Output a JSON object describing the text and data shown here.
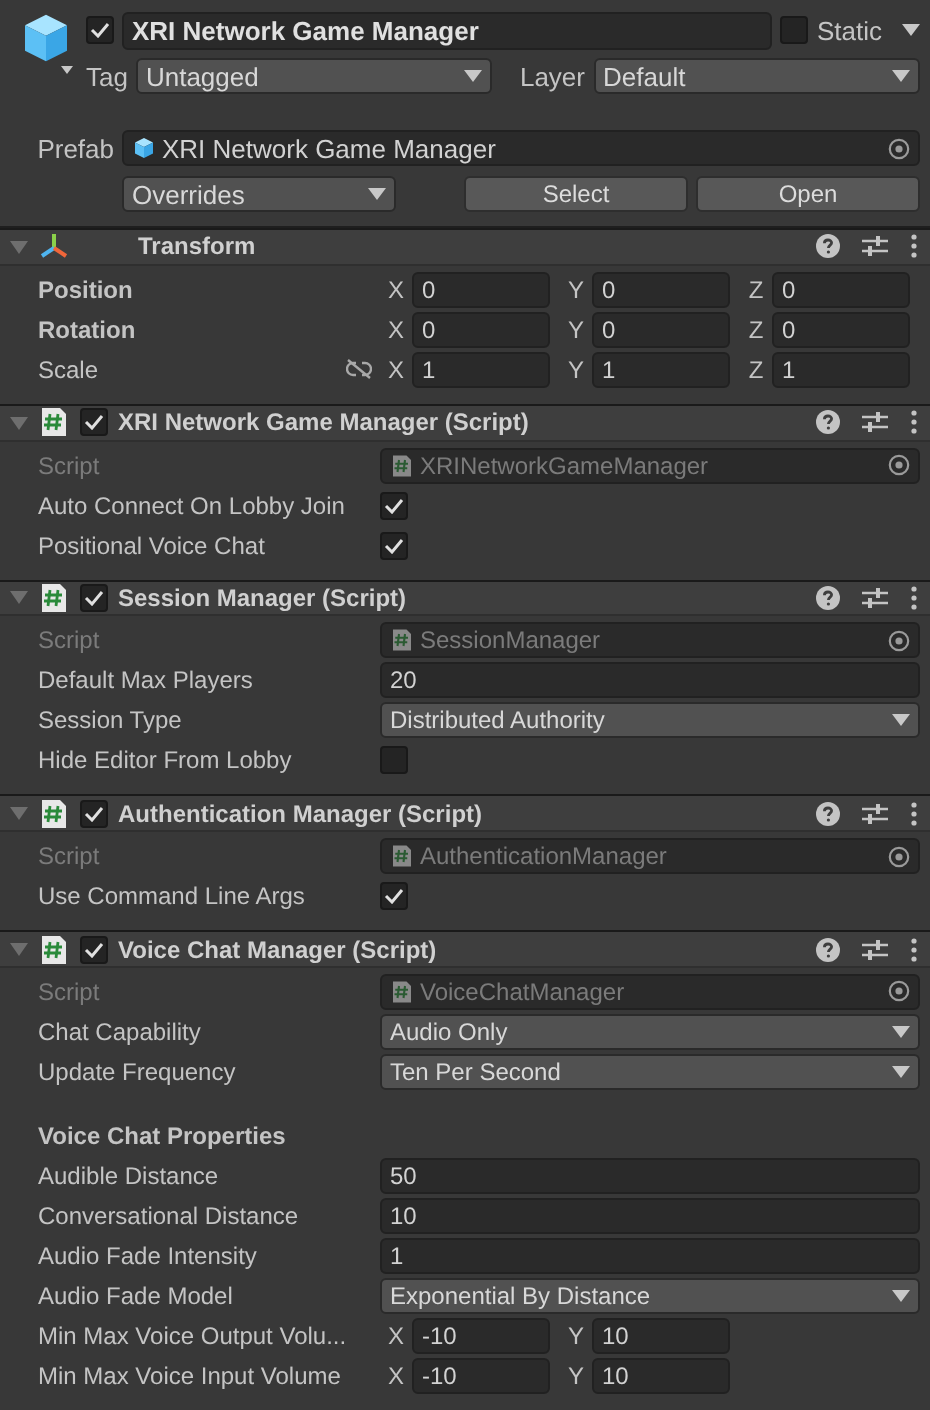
{
  "header": {
    "active": true,
    "name": "XRI Network Game Manager",
    "static": false,
    "static_label": "Static",
    "tag_label": "Tag",
    "tag": "Untagged",
    "layer_label": "Layer",
    "layer": "Default",
    "prefab_label": "Prefab",
    "prefab": "XRI Network Game Manager",
    "overrides": "Overrides",
    "buttons": [
      "Select",
      "Open"
    ]
  },
  "components": [
    {
      "kind": "transform",
      "title": "Transform",
      "expanded": true,
      "rows": [
        {
          "label": "Position",
          "overridden": true,
          "values": [
            {
              "axis": "X",
              "value": "0"
            },
            {
              "axis": "Y",
              "value": "0"
            },
            {
              "axis": "Z",
              "value": "0"
            }
          ]
        },
        {
          "label": "Rotation",
          "overridden": true,
          "values": [
            {
              "axis": "X",
              "value": "0"
            },
            {
              "axis": "Y",
              "value": "0"
            },
            {
              "axis": "Z",
              "value": "0"
            }
          ]
        },
        {
          "label": "Scale",
          "overridden": false,
          "proportional": false,
          "values": [
            {
              "axis": "X",
              "value": "1"
            },
            {
              "axis": "Y",
              "value": "1"
            },
            {
              "axis": "Z",
              "value": "1"
            }
          ]
        }
      ]
    },
    {
      "kind": "script",
      "title": "XRI Network Game Manager (Script)",
      "enabled": true,
      "expanded": true,
      "fields": [
        {
          "kind": "object",
          "label": "Script",
          "value": "XRINetworkGameManager",
          "disabled": true
        },
        {
          "kind": "toggle",
          "label": "Auto Connect On Lobby Join",
          "checked": true
        },
        {
          "kind": "toggle",
          "label": "Positional Voice Chat",
          "checked": true
        }
      ]
    },
    {
      "kind": "script",
      "title": "Session Manager (Script)",
      "enabled": true,
      "expanded": true,
      "fields": [
        {
          "kind": "object",
          "label": "Script",
          "value": "SessionManager",
          "disabled": true
        },
        {
          "kind": "text",
          "label": "Default Max Players",
          "value": "20"
        },
        {
          "kind": "enum",
          "label": "Session Type",
          "value": "Distributed Authority"
        },
        {
          "kind": "toggle",
          "label": "Hide Editor From Lobby",
          "checked": false
        }
      ]
    },
    {
      "kind": "script",
      "title": "Authentication Manager (Script)",
      "enabled": true,
      "expanded": true,
      "fields": [
        {
          "kind": "object",
          "label": "Script",
          "value": "AuthenticationManager",
          "disabled": true
        },
        {
          "kind": "toggle",
          "label": "Use Command Line Args",
          "checked": true
        }
      ]
    },
    {
      "kind": "script",
      "title": "Voice Chat Manager (Script)",
      "enabled": true,
      "expanded": true,
      "fields": [
        {
          "kind": "object",
          "label": "Script",
          "value": "VoiceChatManager",
          "disabled": true
        },
        {
          "kind": "enum",
          "label": "Chat Capability",
          "value": "Audio Only"
        },
        {
          "kind": "enum",
          "label": "Update Frequency",
          "value": "Ten Per Second"
        },
        {
          "kind": "heading",
          "label": "Voice Chat Properties"
        },
        {
          "kind": "text",
          "label": "Audible Distance",
          "value": "50"
        },
        {
          "kind": "text",
          "label": "Conversational Distance",
          "value": "10"
        },
        {
          "kind": "text",
          "label": "Audio Fade Intensity",
          "value": "1"
        },
        {
          "kind": "enum",
          "label": "Audio Fade Model",
          "value": "Exponential By Distance"
        },
        {
          "kind": "vector",
          "label": "Min Max Voice Output Volu...",
          "values": [
            {
              "axis": "X",
              "value": "-10"
            },
            {
              "axis": "Y",
              "value": "10"
            }
          ]
        },
        {
          "kind": "vector",
          "label": "Min Max Voice Input Volume",
          "values": [
            {
              "axis": "X",
              "value": "-10"
            },
            {
              "axis": "Y",
              "value": "10"
            }
          ]
        }
      ]
    }
  ]
}
